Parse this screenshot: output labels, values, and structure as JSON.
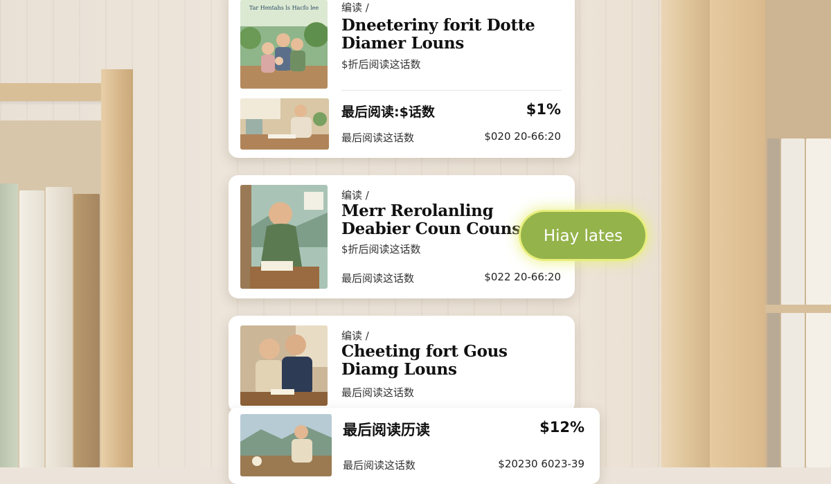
{
  "cards": [
    {
      "thumb_caption": "Tar Hentahs ls Hacfo lee",
      "kicker": "编读 /",
      "title_line1": "Dneeteriny forit Dotte",
      "title_line2": "Diamer Louns",
      "subtitle": "$折后阅读这话数",
      "progress_label": "最后阅读:$话数",
      "progress_value": "$1%",
      "meta_label": "最后阅读这话数",
      "meta_value": "$020 20-66:20"
    },
    {
      "kicker": "编读 /",
      "title_line1": "Merr Rerolanling",
      "title_line2": "Deabier Coun Couns",
      "subtitle": "$折后阅读这话数",
      "meta_label": "最后阅读这话数",
      "meta_value": "$022 20-66:20"
    },
    {
      "kicker": "编读 /",
      "title_line1": "Cheeting fort Gous",
      "title_line2": "Diamg Louns",
      "subtitle": "最后阅读这话数"
    },
    {
      "progress_label": "最后阅读历读",
      "progress_value": "$12%",
      "meta_label": "最后阅读这话数",
      "meta_value": "$20230 6023-39"
    }
  ],
  "cta": {
    "label": "Hiay lates"
  },
  "colors": {
    "cta_bg": "#94b34b",
    "cta_glow": "#e8ee7c"
  }
}
